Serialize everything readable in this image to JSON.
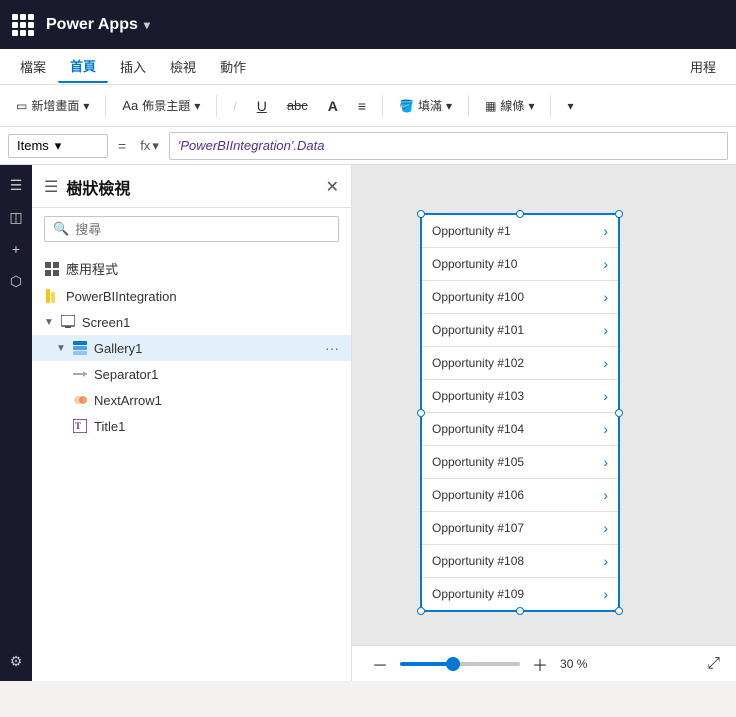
{
  "app": {
    "title": "Power Apps",
    "chevron": "▾"
  },
  "menu": {
    "items": [
      "檔案",
      "首頁",
      "插入",
      "檢視",
      "動作"
    ],
    "active": "首頁",
    "right": "用程"
  },
  "toolbar": {
    "new_screen": "新增畫面",
    "theme": "佈景主題",
    "fill": "填滿",
    "border": "線條",
    "sep1": "/",
    "more": "▾"
  },
  "formula_bar": {
    "name_box": "Items",
    "equals": "=",
    "fx": "fx",
    "formula": "'PowerBIIntegration'.Data"
  },
  "tree_panel": {
    "title": "樹狀檢視",
    "search_placeholder": "搜尋",
    "items": [
      {
        "label": "應用程式",
        "level": 0,
        "icon": "app",
        "expanded": false
      },
      {
        "label": "PowerBIIntegration",
        "level": 0,
        "icon": "powerbi",
        "expanded": false
      },
      {
        "label": "Screen1",
        "level": 0,
        "icon": "screen",
        "expanded": true,
        "has_expand": true
      },
      {
        "label": "Gallery1",
        "level": 1,
        "icon": "gallery",
        "expanded": true,
        "has_expand": true,
        "selected": true,
        "has_dots": true
      },
      {
        "label": "Separator1",
        "level": 2,
        "icon": "separator",
        "expanded": false
      },
      {
        "label": "NextArrow1",
        "level": 2,
        "icon": "nextarrow",
        "expanded": false
      },
      {
        "label": "Title1",
        "level": 2,
        "icon": "title",
        "expanded": false
      }
    ]
  },
  "gallery": {
    "items": [
      "Opportunity #1",
      "Opportunity #10",
      "Opportunity #100",
      "Opportunity #101",
      "Opportunity #102",
      "Opportunity #103",
      "Opportunity #104",
      "Opportunity #105",
      "Opportunity #106",
      "Opportunity #107",
      "Opportunity #108",
      "Opportunity #109"
    ]
  },
  "zoom": {
    "minus": "－",
    "plus": "＋",
    "percent": "30 %",
    "expand": "⤢"
  }
}
